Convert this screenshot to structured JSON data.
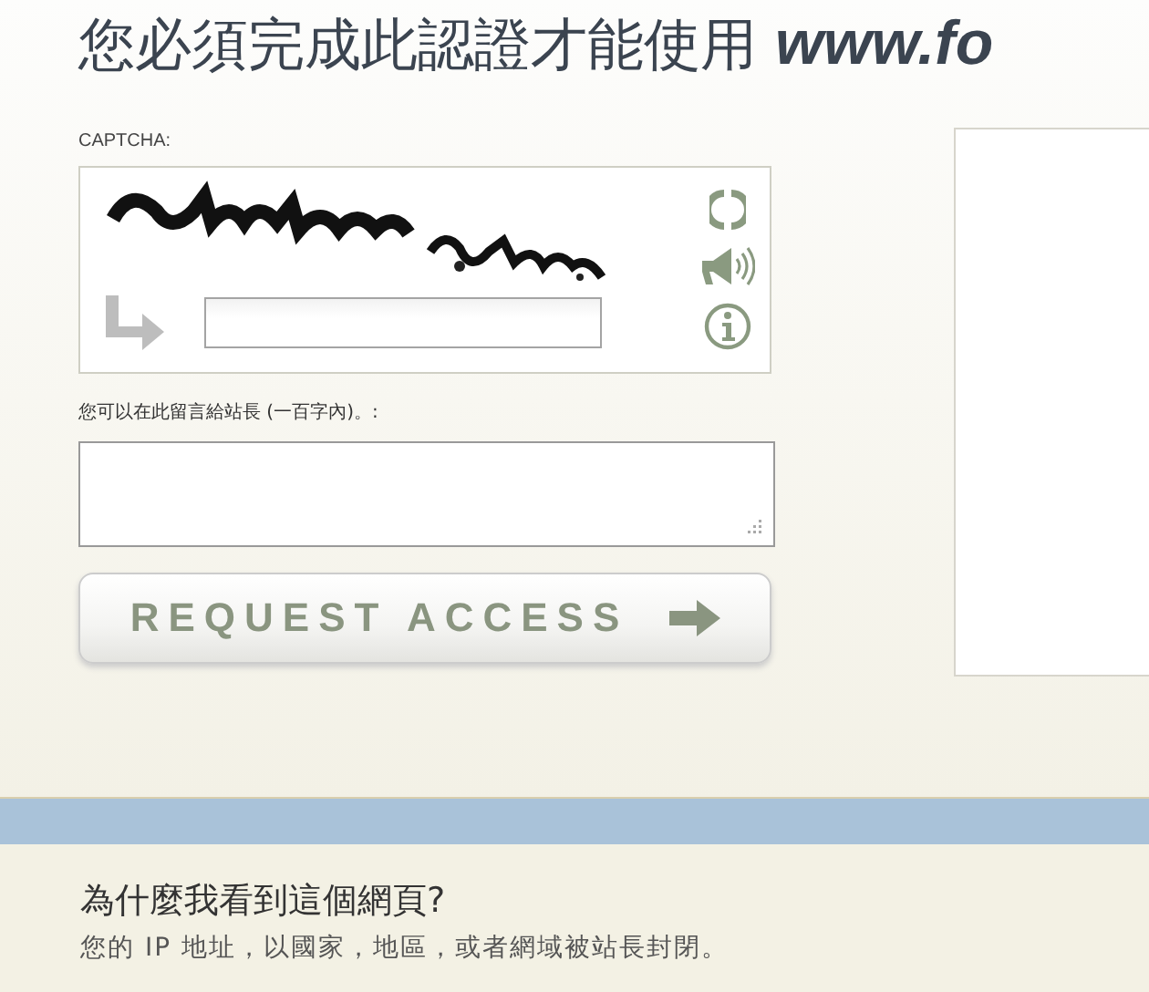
{
  "heading": {
    "text": "您必須完成此認證才能使用",
    "site": "www.fo"
  },
  "captcha": {
    "label": "CAPTCHA:"
  },
  "message": {
    "label": "您可以在此留言給站長 (一百字內)。:"
  },
  "submit": {
    "label": "REQUEST ACCESS"
  },
  "why": {
    "title": "為什麼我看到這個網頁?",
    "text": "您的 IP 地址，以國家，地區，或者網域被站長封閉。"
  }
}
